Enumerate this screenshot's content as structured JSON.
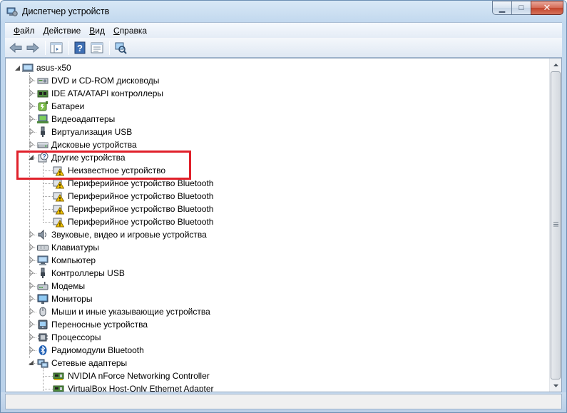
{
  "window": {
    "title": "Диспетчер устройств",
    "controls": {
      "minimize": "▁",
      "maximize": "□",
      "close": "✕"
    }
  },
  "menu": [
    {
      "label": "Файл",
      "hotkey": "Ф",
      "rest": "айл"
    },
    {
      "label": "Действие",
      "hotkey": "Д",
      "rest": "ействие"
    },
    {
      "label": "Вид",
      "hotkey": "В",
      "rest": "ид"
    },
    {
      "label": "Справка",
      "hotkey": "С",
      "rest": "правка"
    }
  ],
  "toolbar": [
    "back-arrow-icon",
    "forward-arrow-icon",
    "show-hide-tree-icon",
    "help-icon",
    "properties-icon",
    "scan-hardware-icon"
  ],
  "tree": {
    "root": "asus-x50",
    "categories": [
      {
        "label": "DVD и CD-ROM дисководы",
        "icon": "dvd-drive-icon"
      },
      {
        "label": "IDE ATA/ATAPI контроллеры",
        "icon": "ide-controller-icon"
      },
      {
        "label": "Батареи",
        "icon": "battery-icon"
      },
      {
        "label": "Видеоадаптеры",
        "icon": "display-adapter-icon"
      },
      {
        "label": "Виртуализация USB",
        "icon": "usb-plug-icon"
      },
      {
        "label": "Дисковые устройства",
        "icon": "disk-drive-icon"
      },
      {
        "label": "Другие устройства",
        "icon": "unknown-device-icon",
        "expanded": true,
        "children": [
          "Неизвестное устройство",
          "Периферийное устройство Bluetooth",
          "Периферийное устройство Bluetooth",
          "Периферийное устройство Bluetooth",
          "Периферийное устройство Bluetooth"
        ]
      },
      {
        "label": "Звуковые, видео и игровые устройства",
        "icon": "speaker-icon"
      },
      {
        "label": "Клавиатуры",
        "icon": "keyboard-icon"
      },
      {
        "label": "Компьютер",
        "icon": "computer-icon"
      },
      {
        "label": "Контроллеры USB",
        "icon": "usb-plug-icon"
      },
      {
        "label": "Модемы",
        "icon": "modem-icon"
      },
      {
        "label": "Мониторы",
        "icon": "monitor-icon"
      },
      {
        "label": "Мыши и иные указывающие устройства",
        "icon": "mouse-icon"
      },
      {
        "label": "Переносные устройства",
        "icon": "portable-device-icon"
      },
      {
        "label": "Процессоры",
        "icon": "processor-icon"
      },
      {
        "label": "Радиомодули Bluetooth",
        "icon": "bluetooth-icon"
      },
      {
        "label": "Сетевые адаптеры",
        "icon": "network-adapter-icon",
        "expanded": true,
        "children": [
          "NVIDIA nForce Networking Controller",
          "VirtualBox Host-Only Ethernet Adapter"
        ]
      }
    ]
  },
  "colors": {
    "highlight": "#e0202a",
    "warning": "#f3c400"
  }
}
